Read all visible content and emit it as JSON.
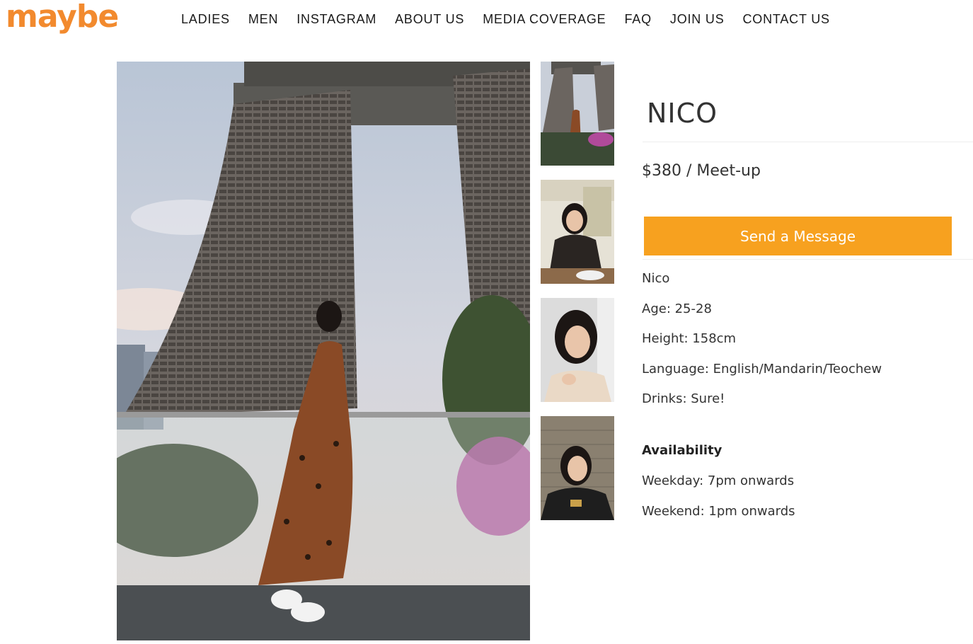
{
  "brand": {
    "logo_text": "maybe",
    "accent": "#f28a2e"
  },
  "nav": {
    "items": [
      "LADIES",
      "MEN",
      "INSTAGRAM",
      "ABOUT US",
      "MEDIA COVERAGE",
      "FAQ",
      "JOIN US",
      "CONTACT US"
    ]
  },
  "profile": {
    "name": "NICO",
    "price": "$380 / Meet-up",
    "send_label": "Send a Message",
    "button_color": "#f7a11f",
    "details": [
      "Nico",
      "Age: 25-28",
      "Height: 158cm",
      "Language: English/Mandarin/Teochew",
      "Drinks: Sure!"
    ],
    "availability_title": "Availability",
    "availability": [
      "Weekday: 7pm onwards",
      "Weekend: 1pm onwards"
    ]
  },
  "gallery": {
    "main_photo": "main-photo",
    "thumbnails": [
      "thumb-1",
      "thumb-2",
      "thumb-3",
      "thumb-4"
    ]
  }
}
